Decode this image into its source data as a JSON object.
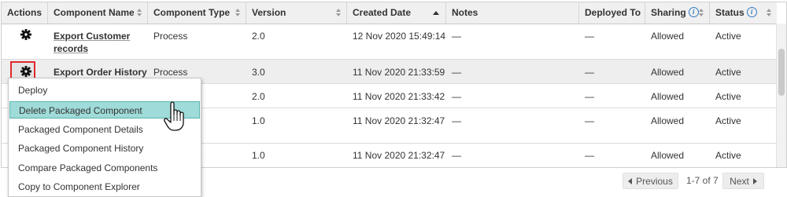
{
  "table": {
    "headers": {
      "actions": "Actions",
      "component_name": "Component Name",
      "component_type": "Component Type",
      "version": "Version",
      "created_date": "Created Date",
      "notes": "Notes",
      "deployed_to": "Deployed To",
      "sharing": "Sharing",
      "status": "Status"
    },
    "info_icon": "i",
    "rows": [
      {
        "name_line1": "Export Customer",
        "name_line2": "records",
        "type": "Process",
        "version": "2.0",
        "created": "12 Nov 2020 15:49:14",
        "notes": "—",
        "deployed": "—",
        "sharing": "Allowed",
        "status": "Active"
      },
      {
        "name_line1": "Export Order History",
        "type": "Process",
        "version": "3.0",
        "created": "11 Nov 2020 21:33:59",
        "notes": "—",
        "deployed": "—",
        "sharing": "Allowed",
        "status": "Active"
      },
      {
        "version": "2.0",
        "created": "11 Nov 2020 21:33:42",
        "notes": "—",
        "deployed": "—",
        "sharing": "Allowed",
        "status": "Active"
      },
      {
        "version": "1.0",
        "created": "11 Nov 2020 21:32:47",
        "notes": "—",
        "deployed": "—",
        "sharing": "Allowed",
        "status": "Active"
      },
      {
        "version": "1.0",
        "created": "11 Nov 2020 21:32:47",
        "notes": "—",
        "deployed": "—",
        "sharing": "Allowed",
        "status": "Active"
      }
    ]
  },
  "actions_menu": {
    "items": [
      "Deploy",
      "Delete Packaged Component",
      "Packaged Component Details",
      "Packaged Component History",
      "Compare Packaged Components",
      "Copy to Component Explorer"
    ],
    "highlighted_index": 1
  },
  "pagination": {
    "previous": "Previous",
    "count": "1-7 of 7",
    "next": "Next"
  },
  "colors": {
    "highlight_bg": "#9fdbd8",
    "focus_outline": "#e0292d",
    "info_blue": "#2f79c4"
  },
  "icons": [
    "gear-icon",
    "sort-icon",
    "info-icon",
    "hand-cursor-icon",
    "chevron-left-icon",
    "chevron-right-icon"
  ]
}
